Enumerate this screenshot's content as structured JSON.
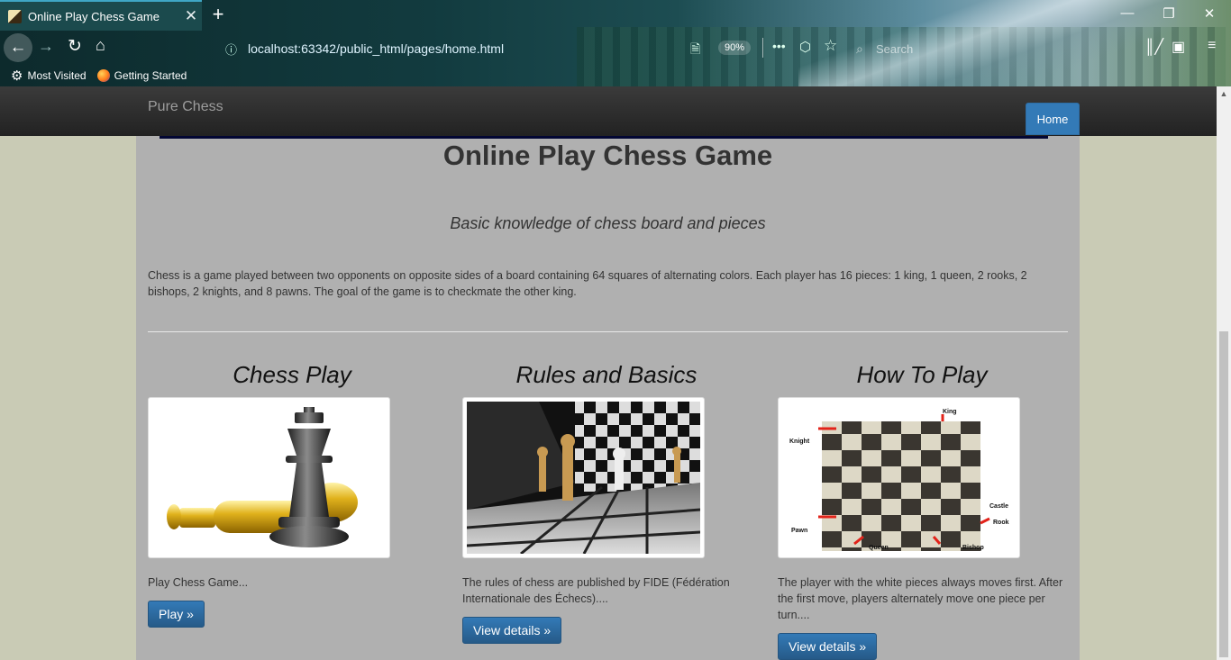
{
  "browser": {
    "tab_title": "Online Play Chess Game",
    "tab_close": "✕",
    "new_tab": "+",
    "url": "localhost:63342/public_html/pages/home.html",
    "zoom": "90%",
    "search_placeholder": "Search",
    "bookmarks": [
      {
        "label": "Most Visited",
        "icon": "gear-icon"
      },
      {
        "label": "Getting Started",
        "icon": "firefox-icon"
      }
    ]
  },
  "navbar": {
    "brand": "Pure Chess",
    "home_label": "Home"
  },
  "page": {
    "title": "Online Play Chess Game",
    "subtitle": "Basic knowledge of chess board and pieces",
    "intro": "Chess is a game played between two opponents on opposite sides of a board containing 64 squares of alternating colors. Each player has 16 pieces: 1 king, 1 queen, 2 rooks, 2 bishops, 2 knights, and 8 pawns. The goal of the game is to checkmate the other king.",
    "columns": [
      {
        "heading": "Chess Play",
        "text": "Play Chess Game...",
        "button": "Play »"
      },
      {
        "heading": "Rules and Basics",
        "text": "The rules of chess are published by FIDE (Fédération Internationale des Échecs)....",
        "button": "View details »"
      },
      {
        "heading": "How To Play",
        "text": "The player with the white pieces always moves first. After the first move, players alternately move one piece per turn....",
        "button": "View details »"
      }
    ],
    "diagram_labels": {
      "king": "King",
      "knight": "Knight",
      "castle": "Castle",
      "rook": "Rook",
      "pawn": "Pawn",
      "queen": "Queen",
      "bishop": "Bishop"
    }
  },
  "colors": {
    "accent": "#337ab7",
    "navbar": "#222222",
    "content_bg": "#b0b0b0",
    "page_bg": "#c9cbb5"
  }
}
